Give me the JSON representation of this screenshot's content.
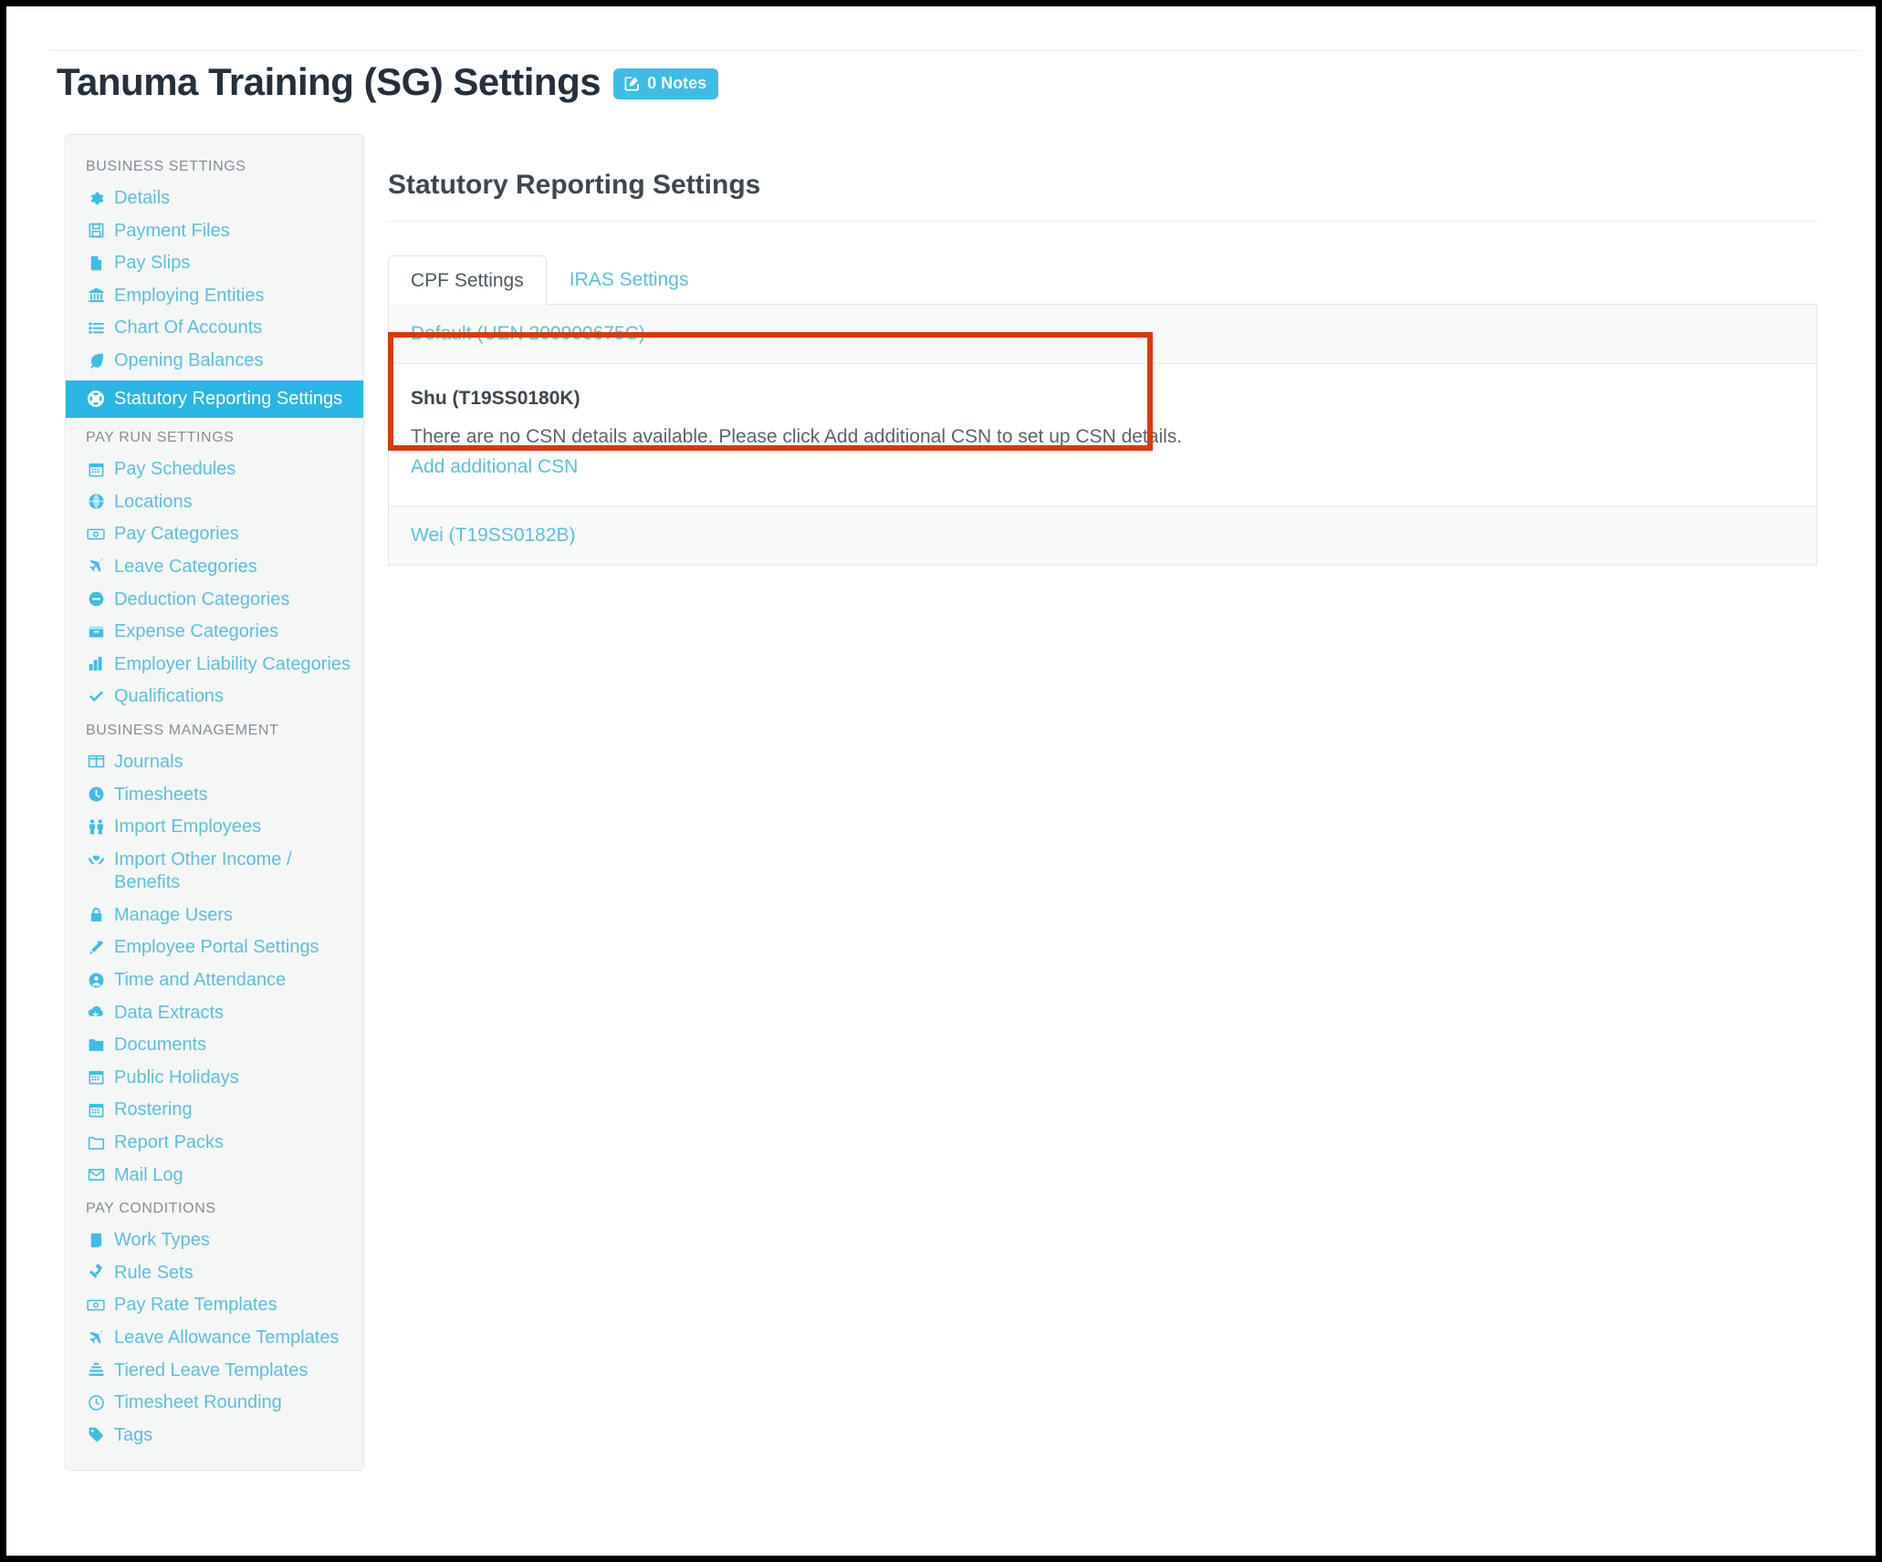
{
  "header": {
    "title": "Tanuma Training (SG) Settings",
    "notes_badge": "0 Notes",
    "notes_icon": "edit-square-icon",
    "badge_color": "#3dbde6"
  },
  "sidebar": {
    "groups": [
      {
        "label": "BUSINESS SETTINGS",
        "items": [
          {
            "label": "Details",
            "icon": "gear-icon",
            "active": false
          },
          {
            "label": "Payment Files",
            "icon": "floppy-disk-icon",
            "active": false
          },
          {
            "label": "Pay Slips",
            "icon": "file-icon",
            "active": false
          },
          {
            "label": "Employing Entities",
            "icon": "bank-icon",
            "active": false
          },
          {
            "label": "Chart Of Accounts",
            "icon": "list-icon",
            "active": false
          },
          {
            "label": "Opening Balances",
            "icon": "leaf-icon",
            "active": false
          },
          {
            "label": "Statutory Reporting Settings",
            "icon": "lifebuoy-icon",
            "active": true
          }
        ]
      },
      {
        "label": "PAY RUN SETTINGS",
        "items": [
          {
            "label": "Pay Schedules",
            "icon": "calendar-icon",
            "active": false
          },
          {
            "label": "Locations",
            "icon": "globe-icon",
            "active": false
          },
          {
            "label": "Pay Categories",
            "icon": "money-icon",
            "active": false
          },
          {
            "label": "Leave Categories",
            "icon": "plane-icon",
            "active": false
          },
          {
            "label": "Deduction Categories",
            "icon": "minus-circle-icon",
            "active": false
          },
          {
            "label": "Expense Categories",
            "icon": "box-icon",
            "active": false
          },
          {
            "label": "Employer Liability Categories",
            "icon": "bar-chart-icon",
            "active": false
          },
          {
            "label": "Qualifications",
            "icon": "check-icon",
            "active": false
          }
        ]
      },
      {
        "label": "BUSINESS MANAGEMENT",
        "items": [
          {
            "label": "Journals",
            "icon": "columns-icon",
            "active": false
          },
          {
            "label": "Timesheets",
            "icon": "clock-icon",
            "active": false
          },
          {
            "label": "Import Employees",
            "icon": "people-icon",
            "active": false
          },
          {
            "label": "Import Other Income / Benefits",
            "icon": "hands-heart-icon",
            "active": false
          },
          {
            "label": "Manage Users",
            "icon": "lock-icon",
            "active": false
          },
          {
            "label": "Employee Portal Settings",
            "icon": "magic-wand-icon",
            "active": false
          },
          {
            "label": "Time and Attendance",
            "icon": "user-circle-icon",
            "active": false
          },
          {
            "label": "Data Extracts",
            "icon": "cloud-download-icon",
            "active": false
          },
          {
            "label": "Documents",
            "icon": "folder-icon",
            "active": false
          },
          {
            "label": "Public Holidays",
            "icon": "calendar-icon",
            "active": false
          },
          {
            "label": "Rostering",
            "icon": "calendar-icon",
            "active": false
          },
          {
            "label": "Report Packs",
            "icon": "folder-open-icon",
            "active": false
          },
          {
            "label": "Mail Log",
            "icon": "envelope-icon",
            "active": false
          }
        ]
      },
      {
        "label": "PAY CONDITIONS",
        "items": [
          {
            "label": "Work Types",
            "icon": "book-icon",
            "active": false
          },
          {
            "label": "Rule Sets",
            "icon": "gavel-icon",
            "active": false
          },
          {
            "label": "Pay Rate Templates",
            "icon": "money-icon",
            "active": false
          },
          {
            "label": "Leave Allowance Templates",
            "icon": "plane-icon",
            "active": false
          },
          {
            "label": "Tiered Leave Templates",
            "icon": "layers-icon",
            "active": false
          },
          {
            "label": "Timesheet Rounding",
            "icon": "clock-icon",
            "active": false
          },
          {
            "label": "Tags",
            "icon": "tag-icon",
            "active": false
          }
        ]
      }
    ]
  },
  "main": {
    "title": "Statutory Reporting Settings",
    "tabs": [
      {
        "label": "CPF Settings",
        "active": true
      },
      {
        "label": "IRAS Settings",
        "active": false
      }
    ],
    "accordion": {
      "row_default": "Default (UEN 200900675C)",
      "expanded": {
        "title": "Shu (T19SS0180K)",
        "message": "There are no CSN details available. Please click Add additional CSN to set up CSN details.",
        "link": "Add additional CSN"
      },
      "row_wei": "Wei (T19SS0182B)"
    },
    "highlight_color": "#d93a0b"
  }
}
